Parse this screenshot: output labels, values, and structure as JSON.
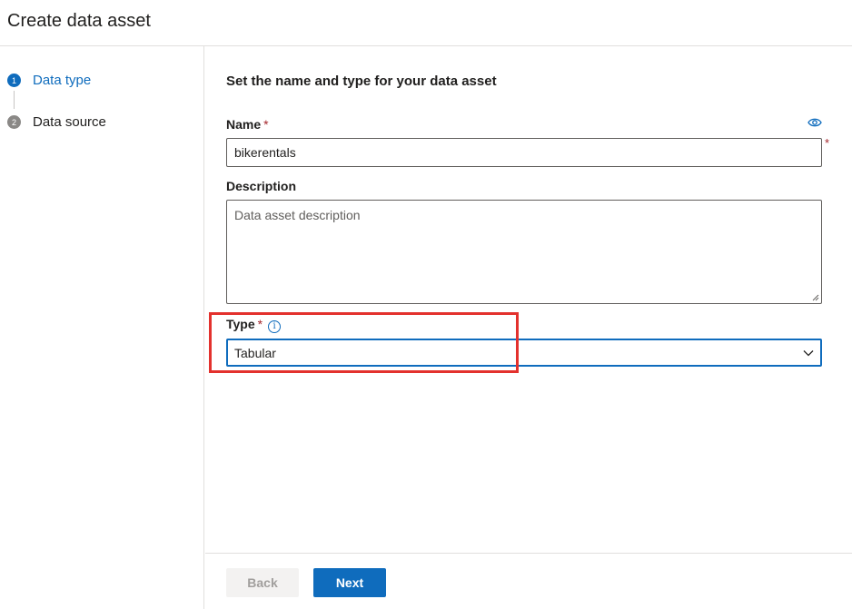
{
  "header": {
    "title": "Create data asset"
  },
  "steps": [
    {
      "number": "1",
      "label": "Data type",
      "state": "active"
    },
    {
      "number": "2",
      "label": "Data source",
      "state": "inactive"
    }
  ],
  "form": {
    "section_title": "Set the name and type for your data asset",
    "name": {
      "label": "Name",
      "required_mark": "*",
      "value": "bikerentals"
    },
    "description": {
      "label": "Description",
      "placeholder": "Data asset description"
    },
    "type": {
      "label": "Type",
      "required_mark": "*",
      "info_glyph": "i",
      "selected": "Tabular"
    }
  },
  "footer": {
    "back_label": "Back",
    "next_label": "Next"
  },
  "colors": {
    "accent": "#0f6cbd",
    "required": "#a4262c",
    "highlight": "#e3312d"
  }
}
